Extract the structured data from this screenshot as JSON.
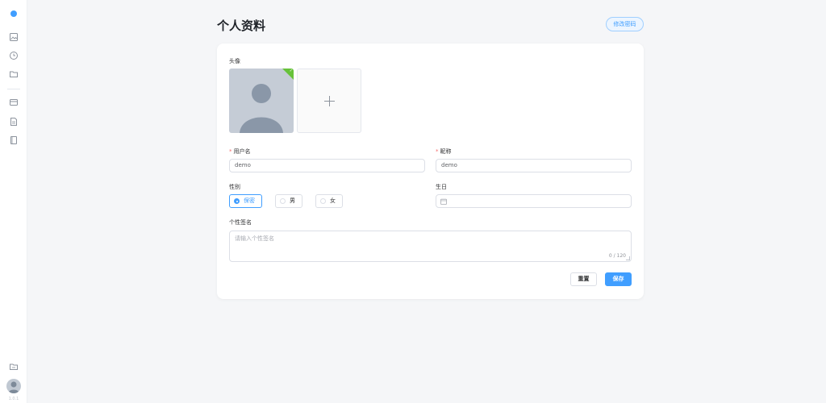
{
  "sidebar": {
    "icons": [
      "image-icon",
      "clock-icon",
      "folder-icon",
      "card-icon",
      "document-icon",
      "book-icon",
      "folder-bottom-icon"
    ],
    "version": "1.0.1"
  },
  "header": {
    "title": "个人资料",
    "change_password": "修改密码"
  },
  "form": {
    "avatar_label": "头像",
    "username": {
      "label": "用户名",
      "value": "demo"
    },
    "nickname": {
      "label": "昵称",
      "value": "demo"
    },
    "gender": {
      "label": "性别",
      "options": [
        "保密",
        "男",
        "女"
      ],
      "selected": "保密"
    },
    "birthday": {
      "label": "生日",
      "value": ""
    },
    "signature": {
      "label": "个性签名",
      "placeholder": "请输入个性签名",
      "counter": "0 / 120"
    },
    "buttons": {
      "reset": "重置",
      "save": "保存"
    }
  },
  "colors": {
    "primary": "#409eff",
    "success": "#67c23a",
    "required": "#f56c6c"
  }
}
